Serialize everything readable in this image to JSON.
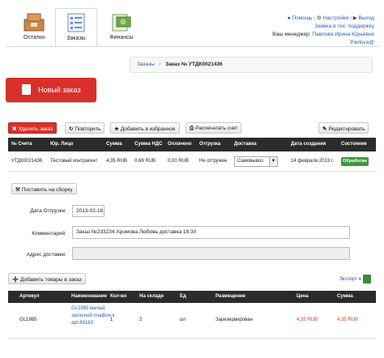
{
  "nav": {
    "tabs": [
      {
        "label": "Остатки",
        "icon": "boxes-icon"
      },
      {
        "label": "Заказы",
        "icon": "orders-list-icon",
        "active": true
      },
      {
        "label": "Финансы",
        "icon": "money-icon"
      }
    ]
  },
  "top_links": {
    "help": "Помощь",
    "settings": "Настройки",
    "exit": "Выход",
    "support": "Заявка в тех. поддержку",
    "manager_prefix": "Ваш менеджер:",
    "manager_name": "Павлова Ирина Юрьевна",
    "manager_email": "Pavlova@"
  },
  "breadcrumb": {
    "root": "Заказы",
    "separator": "/",
    "current": "Заказ № УТДК0021436"
  },
  "new_order_label": "Новый заказ",
  "toolbar": {
    "delete": "Удалить заказ",
    "repeat": "Повторить",
    "favorite": "Добавить в избранное",
    "print": "Распечатать счет",
    "edit": "Редактировать"
  },
  "order_table": {
    "headers": [
      "№ Счета",
      "Юр. Лицо",
      "Сумма",
      "Сумма НДС",
      "Оплачено",
      "Отгрузка",
      "Доставка",
      "Дата создания",
      "Состояние"
    ],
    "row": {
      "invoice": "УТДК0021436",
      "entity": "Тестовый контрагент",
      "sum": "4,35 RUB",
      "vat": "0,66 RUB",
      "paid": "0,00 RUB",
      "shipment": "Не отгружен",
      "delivery": "Самовывоз",
      "created": "14 февраля 2013 г.",
      "status": "Обработан"
    }
  },
  "assembly_button": "Поставить на сборку",
  "form": {
    "ship_date_label": "Дата Отгрузки:",
    "ship_date_value": "2013-02-18",
    "comment_label": "Комментарий:",
    "comment_value": "Заказ №233234 Хромова Любовь доставка 18:30",
    "address_label": "Адрес доставки:",
    "address_value": ""
  },
  "add_goods_button": "Добавить товары в заказ",
  "export_label": "Экспорт в",
  "goods_table": {
    "headers": [
      "Артикул",
      "Наименование",
      "Кол-во",
      "На складе",
      "Ед",
      "Размещение",
      "Цена",
      "Сумма"
    ],
    "rows": [
      {
        "article": "GL1985",
        "name": "GL1985 малый запасной плафон к арт.89183",
        "qty": "1",
        "stock": "2",
        "unit": "шт",
        "placement": "Зарезервирован",
        "price": "4,35 RUB",
        "sum": "4,35 RUB"
      }
    ]
  },
  "colors": {
    "accent_red": "#d9302b",
    "header_dark": "#2b2b2b",
    "status_green": "#3c9b3c",
    "link_blue": "#2a5db0"
  }
}
